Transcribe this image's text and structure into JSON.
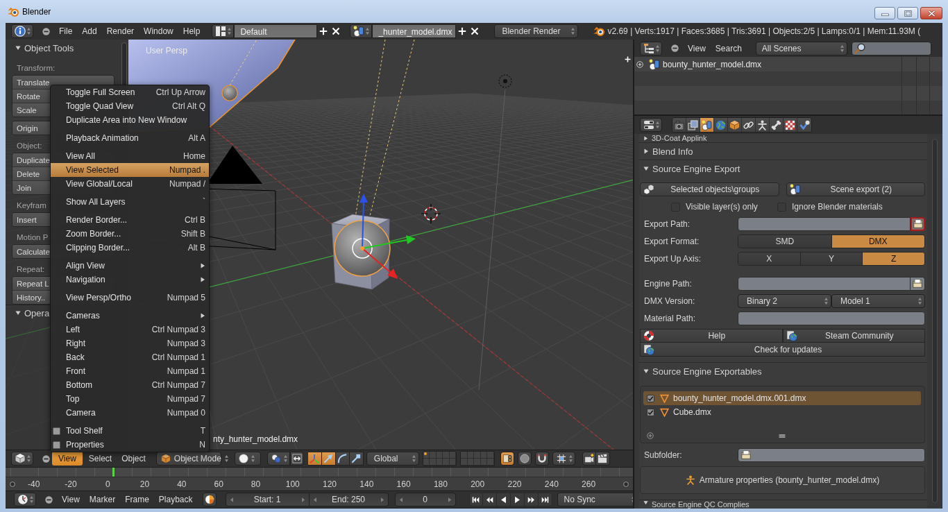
{
  "window": {
    "title": "Blender"
  },
  "info_header": {
    "menus": [
      "File",
      "Add",
      "Render",
      "Window",
      "Help"
    ],
    "screen_layout": "Default",
    "scene": "_hunter_model.dmx",
    "render_engine": "Blender Render",
    "stats": "v2.69 | Verts:1917 | Faces:3685 | Tris:3691 | Objects:2/5 | Lamps:0/1 | Mem:11.93M ("
  },
  "viewport": {
    "view_name": "User Persp",
    "object_name": "nty_hunter_model.dmx",
    "tool_shelf": {
      "panels": [
        {
          "title": "Object Tools",
          "expanded": true,
          "items": [
            {
              "kind": "heading",
              "label": "Transform:"
            },
            {
              "kind": "buttons",
              "labels": [
                "Translate",
                "Rotate",
                "Scale"
              ]
            },
            {
              "kind": "buttons",
              "labels": [
                "Origin"
              ]
            },
            {
              "kind": "heading",
              "label": "Object:"
            },
            {
              "kind": "buttons",
              "labels": [
                "Duplicate",
                "Delete",
                "Join"
              ]
            },
            {
              "kind": "heading",
              "label": "Keyfram"
            },
            {
              "kind": "buttons",
              "labels": [
                "Insert"
              ]
            },
            {
              "kind": "heading",
              "label": "Motion P"
            },
            {
              "kind": "buttons",
              "labels": [
                "Calculate"
              ]
            },
            {
              "kind": "heading",
              "label": "Repeat:"
            },
            {
              "kind": "buttons",
              "labels": [
                "Repeat L",
                "History.."
              ]
            }
          ]
        },
        {
          "title": "Opera",
          "expanded": true
        }
      ]
    },
    "menu": {
      "groups": [
        [
          {
            "kind": "command",
            "label": "Toggle Full Screen",
            "shortcut": "Ctrl Up Arrow",
            "selected": false
          },
          {
            "kind": "command",
            "label": "Toggle Quad View",
            "shortcut": "Ctrl Alt Q",
            "selected": false
          },
          {
            "kind": "command",
            "label": "Duplicate Area into New Window",
            "selected": false
          }
        ],
        [
          {
            "kind": "command",
            "label": "Playback Animation",
            "shortcut": "Alt A",
            "selected": false
          }
        ],
        [
          {
            "kind": "command",
            "label": "View All",
            "shortcut": "Home",
            "selected": false
          },
          {
            "kind": "command",
            "label": "View Selected",
            "shortcut": "Numpad .",
            "selected": true
          },
          {
            "kind": "command",
            "label": "View Global/Local",
            "shortcut": "Numpad /",
            "selected": false
          }
        ],
        [
          {
            "kind": "command",
            "label": "Show All Layers",
            "shortcut": "`",
            "selected": false
          }
        ],
        [
          {
            "kind": "command",
            "label": "Render Border...",
            "shortcut": "Ctrl B",
            "selected": false
          },
          {
            "kind": "command",
            "label": "Zoom Border...",
            "shortcut": "Shift B",
            "selected": false
          },
          {
            "kind": "command",
            "label": "Clipping Border...",
            "shortcut": "Alt B",
            "selected": false
          }
        ],
        [
          {
            "kind": "submenu",
            "label": "Align View",
            "selected": false
          },
          {
            "kind": "submenu",
            "label": "Navigation",
            "selected": false
          }
        ],
        [
          {
            "kind": "command",
            "label": "View Persp/Ortho",
            "shortcut": "Numpad 5",
            "selected": false
          }
        ],
        [
          {
            "kind": "submenu",
            "label": "Cameras",
            "selected": false
          },
          {
            "kind": "command",
            "label": "Left",
            "shortcut": "Ctrl Numpad 3",
            "selected": false
          },
          {
            "kind": "command",
            "label": "Right",
            "shortcut": "Numpad 3",
            "selected": false
          },
          {
            "kind": "command",
            "label": "Back",
            "shortcut": "Ctrl Numpad 1",
            "selected": false
          },
          {
            "kind": "command",
            "label": "Front",
            "shortcut": "Numpad 1",
            "selected": false
          },
          {
            "kind": "command",
            "label": "Bottom",
            "shortcut": "Ctrl Numpad 7",
            "selected": false
          },
          {
            "kind": "command",
            "label": "Top",
            "shortcut": "Numpad 7",
            "selected": false
          },
          {
            "kind": "command",
            "label": "Camera",
            "shortcut": "Numpad 0",
            "selected": false
          }
        ],
        [
          {
            "kind": "toggle",
            "label": "Tool Shelf",
            "shortcut": "T",
            "selected": false
          },
          {
            "kind": "toggle",
            "label": "Properties",
            "shortcut": "N",
            "selected": false
          }
        ]
      ]
    }
  },
  "viewport_header": {
    "menus": [
      {
        "label": "View",
        "selected": true
      },
      {
        "label": "Select",
        "selected": false
      },
      {
        "label": "Object",
        "selected": false
      }
    ],
    "mode": "Object Mode",
    "transform_toggles": [
      {
        "kind": "origins",
        "on": false
      },
      {
        "kind": "manipulator",
        "on": true
      },
      {
        "kind": "translate",
        "on": true
      },
      {
        "kind": "rotate",
        "on": false
      },
      {
        "kind": "scale",
        "on": false
      }
    ],
    "orientation": "Global",
    "layers": [
      {
        "selected": false,
        "used": true
      },
      {
        "selected": false,
        "used": false
      },
      {
        "selected": false,
        "used": false
      },
      {
        "selected": false,
        "used": false
      },
      {
        "selected": false,
        "used": false
      },
      {
        "selected": false,
        "used": false
      },
      {
        "selected": false,
        "used": false
      },
      {
        "selected": false,
        "used": false
      },
      {
        "selected": false,
        "used": false
      },
      {
        "selected": false,
        "used": false
      },
      {
        "selected": false,
        "used": false
      },
      {
        "selected": false,
        "used": false
      },
      {
        "selected": false,
        "used": false
      },
      {
        "selected": false,
        "used": false
      },
      {
        "selected": false,
        "used": false
      },
      {
        "selected": false,
        "used": false
      },
      {
        "selected": false,
        "used": false
      },
      {
        "selected": false,
        "used": false
      },
      {
        "selected": false,
        "used": false
      },
      {
        "selected": false,
        "used": false
      }
    ],
    "snap_toggles": [
      {
        "kind": "lock",
        "on": true
      },
      {
        "kind": "proportional",
        "on": false
      },
      {
        "kind": "snap",
        "on": false
      }
    ]
  },
  "timeline": {
    "ticks": [
      "-40",
      "-20",
      "0",
      "20",
      "40",
      "60",
      "80",
      "100",
      "120",
      "140",
      "160",
      "180",
      "200",
      "220",
      "240",
      "260"
    ],
    "playhead": {
      "level": 0.171
    }
  },
  "timeline_header": {
    "menus": [
      "View",
      "Marker",
      "Frame",
      "Playback"
    ],
    "start": "Start: 1",
    "end": "End: 250",
    "frame": "0",
    "sync": "No Sync"
  },
  "outliner": {
    "menus": [
      "View",
      "Search"
    ],
    "filter": "All Scenes",
    "rows": [
      {
        "label": "bounty_hunter_model.dmx",
        "expanded": false
      }
    ]
  },
  "properties": {
    "tabs": [
      {
        "kind": "render",
        "selected": false
      },
      {
        "kind": "render_layers",
        "selected": false
      },
      {
        "kind": "scene",
        "selected": true
      },
      {
        "kind": "world",
        "selected": false
      },
      {
        "kind": "object",
        "selected": false
      },
      {
        "kind": "constraints",
        "selected": false
      },
      {
        "kind": "data",
        "selected": false
      },
      {
        "kind": "bone",
        "selected": false
      },
      {
        "kind": "texture",
        "selected": false
      },
      {
        "kind": "physics",
        "selected": false
      }
    ],
    "panels": [
      {
        "kind": "header",
        "title": "3D-Coat Applink",
        "expanded": false
      },
      {
        "kind": "header",
        "title": "Blend Info",
        "expanded": false
      },
      {
        "kind": "export",
        "title": "Source Engine Export",
        "expanded": true,
        "actions": [
          {
            "label": "Selected objects\\groups"
          },
          {
            "label": "Scene export (2)"
          }
        ],
        "options": [
          {
            "label": "Visible layer(s) only",
            "checked": false
          },
          {
            "label": "Ignore Blender materials",
            "checked": false
          }
        ],
        "row_groups": [
          [
            {
              "kind": "path",
              "label": "Export Path:",
              "alert": true
            },
            {
              "kind": "choice",
              "label": "Export Format:",
              "options": [
                {
                  "label": "SMD",
                  "selected": false
                },
                {
                  "label": "DMX",
                  "selected": true
                }
              ]
            },
            {
              "kind": "choice",
              "label": "Export Up Axis:",
              "options": [
                {
                  "label": "X",
                  "selected": false
                },
                {
                  "label": "Y",
                  "selected": false
                },
                {
                  "label": "Z",
                  "selected": true
                }
              ]
            }
          ],
          [
            {
              "kind": "path",
              "label": "Engine Path:",
              "alert": false
            },
            {
              "kind": "menus",
              "label": "DMX Version:",
              "values": [
                "Binary 2",
                "Model 1"
              ]
            },
            {
              "kind": "text",
              "label": "Material Path:"
            }
          ]
        ],
        "links": [
          [
            {
              "label": "Help"
            },
            {
              "label": "Steam Community"
            }
          ],
          [
            {
              "label": "Check for updates"
            }
          ]
        ]
      },
      {
        "kind": "list",
        "title": "Source Engine Exportables",
        "expanded": true,
        "items": [
          {
            "label": "bounty_hunter_model.dmx.001.dmx",
            "checked": true,
            "selected": true
          },
          {
            "label": "Cube.dmx",
            "checked": true,
            "selected": false
          }
        ],
        "subfolder_label": "Subfolder:",
        "armature": "Armature properties (bounty_hunter_model.dmx)"
      },
      {
        "kind": "header",
        "title": "Source Engine QC Complies",
        "expanded": true
      }
    ]
  }
}
